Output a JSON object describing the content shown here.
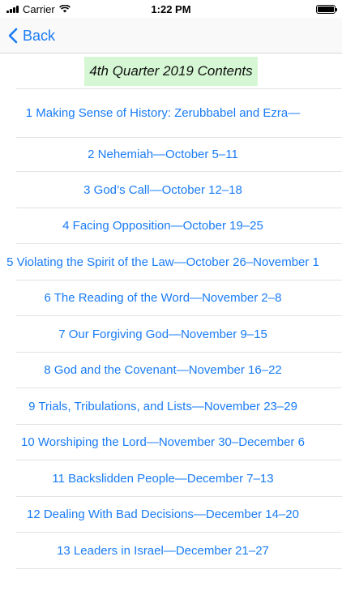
{
  "status": {
    "carrier": "Carrier",
    "time": "1:22 PM"
  },
  "nav": {
    "back_label": "Back"
  },
  "title": "4th Quarter 2019 Contents",
  "lessons": [
    "1 Making Sense of History: Zerubbabel and Ezra—",
    "2 Nehemiah—October 5–11",
    "3 God’s Call—October 12–18",
    "4 Facing Opposition—October 19–25",
    "5 Violating the Spirit of the Law—October 26–November 1",
    "6 The Reading of the Word—November 2–8",
    "7 Our Forgiving God—November 9–15",
    "8 God and the Covenant—November 16–22",
    "9 Trials, Tribulations, and Lists—November 23–29",
    "10 Worshiping the Lord—November 30–December 6",
    "11 Backslidden People—December 7–13",
    "12 Dealing With Bad Decisions—December 14–20",
    "13 Leaders in Israel—December 21–27"
  ],
  "colors": {
    "link": "#1a7cf5",
    "title_bg": "#d6f7d4"
  }
}
